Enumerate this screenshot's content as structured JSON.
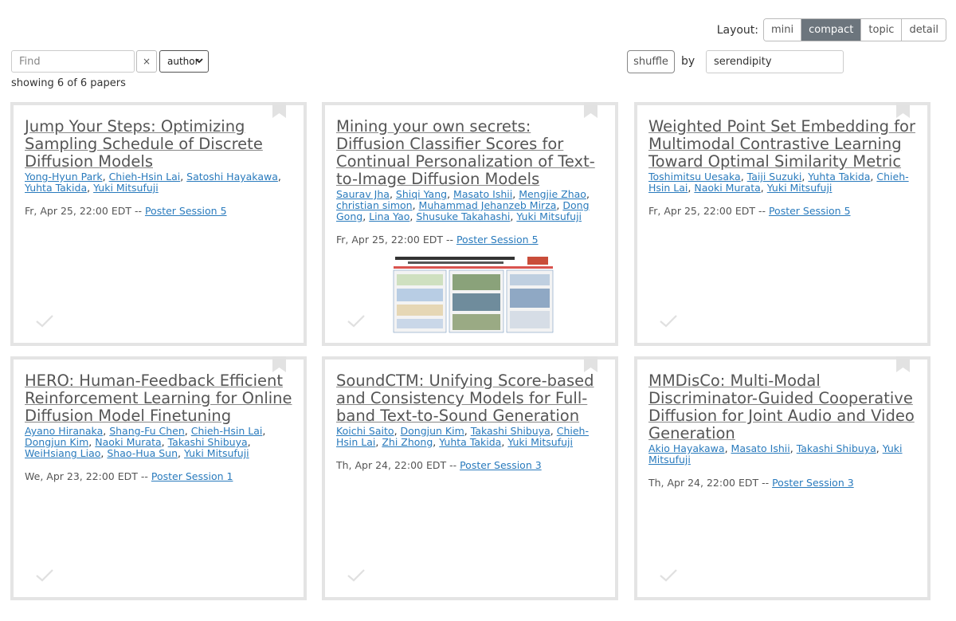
{
  "layout": {
    "label": "Layout:",
    "options": [
      "mini",
      "compact",
      "topic",
      "detail"
    ],
    "active": "compact"
  },
  "search": {
    "placeholder": "Find",
    "clear_label": "×",
    "field_value": "author",
    "showing_text": "showing 6 of 6 papers"
  },
  "sort": {
    "shuffle_label": "shuffle",
    "by_label": "by",
    "value": "serendipity"
  },
  "colors": {
    "link": "#2a7bbd",
    "active_tab": "#6c757d",
    "card_border": "#e4e4e4"
  },
  "papers": [
    {
      "title": "Jump Your Steps: Optimizing Sampling Schedule of Discrete Diffusion Models",
      "authors": [
        "Yong-Hyun Park",
        "Chieh-Hsin Lai",
        "Satoshi Hayakawa",
        "Yuhta Takida",
        "Yuki Mitsufuji"
      ],
      "date": "Fr, Apr 25, 22:00 EDT --",
      "session": "Poster Session 5",
      "has_poster": false
    },
    {
      "title": "Mining your own secrets: Diffusion Classifier Scores for Continual Personalization of Text-to-Image Diffusion Models",
      "authors": [
        "Saurav Jha",
        "Shiqi Yang",
        "Masato Ishii",
        "Mengjie Zhao",
        "christian simon",
        "Muhammad Jehanzeb Mirza",
        "Dong Gong",
        "Lina Yao",
        "Shusuke Takahashi",
        "Yuki Mitsufuji"
      ],
      "date": "Fr, Apr 25, 22:00 EDT --",
      "session": "Poster Session 5",
      "has_poster": true
    },
    {
      "title": "Weighted Point Set Embedding for Multimodal Contrastive Learning Toward Optimal Similarity Metric",
      "authors": [
        "Toshimitsu Uesaka",
        "Taiji Suzuki",
        "Yuhta Takida",
        "Chieh-Hsin Lai",
        "Naoki Murata",
        "Yuki Mitsufuji"
      ],
      "date": "Fr, Apr 25, 22:00 EDT --",
      "session": "Poster Session 5",
      "has_poster": false
    },
    {
      "title": "HERO: Human-Feedback Efficient Reinforcement Learning for Online Diffusion Model Finetuning",
      "authors": [
        "Ayano Hiranaka",
        "Shang-Fu Chen",
        "Chieh-Hsin Lai",
        "Dongjun Kim",
        "Naoki Murata",
        "Takashi Shibuya",
        "WeiHsiang Liao",
        "Shao-Hua Sun",
        "Yuki Mitsufuji"
      ],
      "date": "We, Apr 23, 22:00 EDT --",
      "session": "Poster Session 1",
      "has_poster": false
    },
    {
      "title": "SoundCTM: Unifying Score-based and Consistency Models for Full-band Text-to-Sound Generation",
      "authors": [
        "Koichi Saito",
        "Dongjun Kim",
        "Takashi Shibuya",
        "Chieh-Hsin Lai",
        "Zhi Zhong",
        "Yuhta Takida",
        "Yuki Mitsufuji"
      ],
      "date": "Th, Apr 24, 22:00 EDT --",
      "session": "Poster Session 3",
      "has_poster": false
    },
    {
      "title": "MMDisCo: Multi-Modal Discriminator-Guided Cooperative Diffusion for Joint Audio and Video Generation",
      "authors": [
        "Akio Hayakawa",
        "Masato Ishii",
        "Takashi Shibuya",
        "Yuki Mitsufuji"
      ],
      "date": "Th, Apr 24, 22:00 EDT --",
      "session": "Poster Session 3",
      "has_poster": false
    }
  ]
}
